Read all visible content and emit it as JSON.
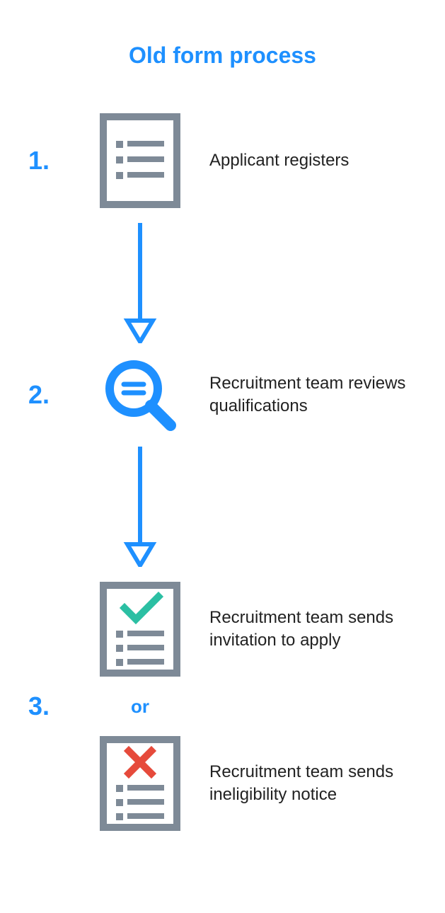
{
  "title": "Old form process",
  "steps": {
    "s1": {
      "num": "1.",
      "text": "Applicant registers"
    },
    "s2": {
      "num": "2.",
      "text": "Recruitment team reviews qualifications"
    },
    "s3": {
      "num": "3.",
      "text_a": "Recruitment team sends invitation to apply",
      "text_b": "Recruitment team sends ineligibility notice",
      "or": "or"
    }
  },
  "colors": {
    "blue": "#1e90ff",
    "gray": "#7e8a97",
    "teal": "#2bbfa3",
    "red": "#e64a3b"
  }
}
